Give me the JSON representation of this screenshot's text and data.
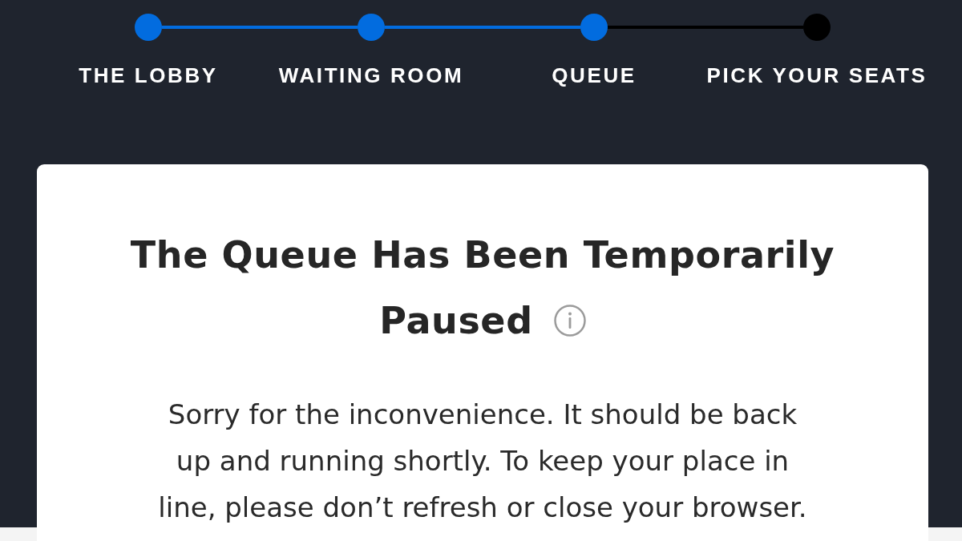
{
  "steps": [
    {
      "label": "THE LOBBY",
      "done": true
    },
    {
      "label": "WAITING ROOM",
      "done": true
    },
    {
      "label": "QUEUE",
      "done": true
    },
    {
      "label": "PICK YOUR SEATS",
      "done": false
    }
  ],
  "card": {
    "title_lines": [
      "The Queue Has Been Temporarily",
      "Paused"
    ],
    "message": "Sorry for the inconvenience. It should be back up and running shortly. To keep your place in line, please don’t refresh or close your browser."
  }
}
